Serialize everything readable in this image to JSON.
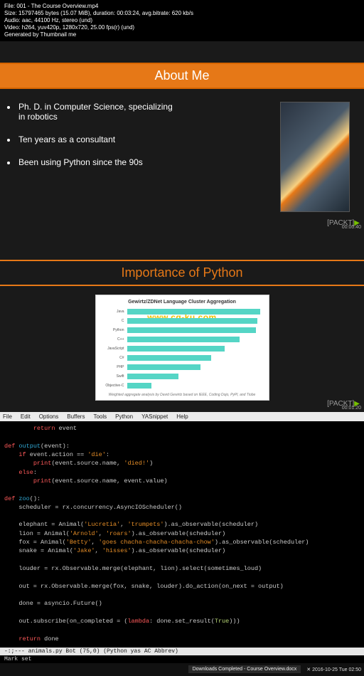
{
  "metadata": {
    "file": "File: 001 - The Course Overview.mp4",
    "size": "Size: 15797465 bytes (15.07 MiB), duration: 00:03:24, avg.bitrate: 620 kb/s",
    "audio": "Audio: aac, 44100 Hz, stereo (und)",
    "video": "Video: h264, yuv420p, 1280x720, 25.00 fps(r) (und)",
    "gen": "Generated by Thumbnail me"
  },
  "slide1": {
    "title": "About Me",
    "bullets": [
      "Ph. D. in Computer Science, specializing in robotics",
      "Ten years as a consultant",
      "Been using Python since the 90s"
    ],
    "brand": "[PACKT]",
    "timestamp": "00:00:40"
  },
  "slide2": {
    "title": "Importance of Python",
    "brand": "[PACKT]",
    "timestamp": "00:01:20",
    "watermark": "www.cg-ku.com",
    "chart_title": "Gewirtz/ZDNet Language Cluster Aggregation",
    "chart_foot": "Weighted aggregate analysis by David Gewirtz based on IEEE, Coding Dojo, PyPl, and Tiobe"
  },
  "chart_data": {
    "type": "bar",
    "orientation": "horizontal",
    "title": "Gewirtz/ZDNet Language Cluster Aggregation",
    "xlabel": "",
    "ylabel": "",
    "xlim": [
      0,
      10
    ],
    "categories": [
      "Java",
      "C",
      "Python",
      "C++",
      "JavaScript",
      "C#",
      "PHP",
      "Swift",
      "Objective-C"
    ],
    "values": [
      9.8,
      9.6,
      9.5,
      8.3,
      7.2,
      6.2,
      5.4,
      3.8,
      1.8
    ]
  },
  "editor": {
    "menu": [
      "File",
      "Edit",
      "Options",
      "Buffers",
      "Tools",
      "Python",
      "YASnippet",
      "Help"
    ],
    "status": "-:;---  animals.py    Bot (75,0)    (Python yas AC Abbrev) ",
    "mini": "Mark set"
  },
  "code": {
    "l0": "        return event",
    "l1": "",
    "l2": "def output(event):",
    "l3": "    if event.action == 'die':",
    "l4": "        print(event.source.name, 'died!')",
    "l5": "    else:",
    "l6": "        print(event.source.name, event.value)",
    "l7": "",
    "l8": "def zoo():",
    "l9": "    scheduler = rx.concurrency.AsyncIOScheduler()",
    "l10": "",
    "l11": "    elephant = Animal('Lucretia', 'trumpets').as_observable(scheduler)",
    "l12": "    lion = Animal('Arnold', 'roars').as_observable(scheduler)",
    "l13": "    fox = Animal('Betty', 'goes chacha-chacha-chacha-chow').as_observable(scheduler)",
    "l14": "    snake = Animal('Jake', 'hisses').as_observable(scheduler)",
    "l15": "",
    "l16": "    louder = rx.Observable.merge(elephant, lion).select(sometimes_loud)",
    "l17": "",
    "l18": "    out = rx.Observable.merge(fox, snake, louder).do_action(on_next = output)",
    "l19": "",
    "l20": "    done = asyncio.Future()",
    "l21": "",
    "l22": "    out.subscribe(on_completed = (lambda: done.set_result(True)))",
    "l23": "",
    "l24": "    return done"
  },
  "taskbar": {
    "download": "Downloads Completed - Course Overview.docx",
    "clock": "✕  2016-10-25 Tue 02:50"
  }
}
